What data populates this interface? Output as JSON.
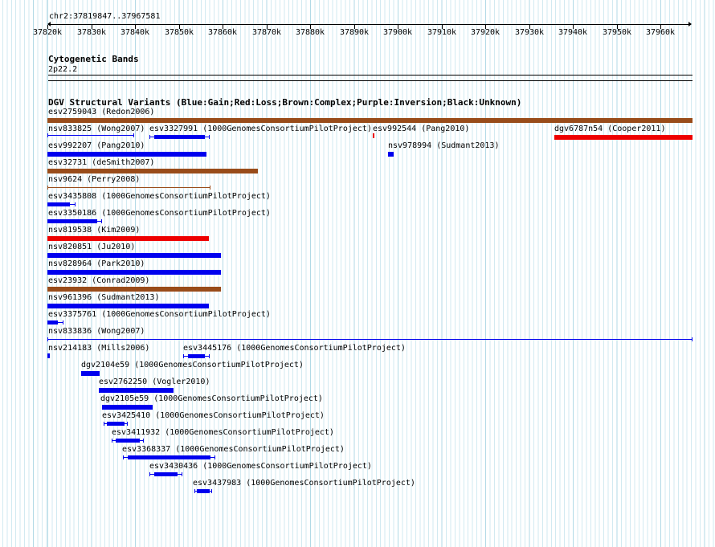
{
  "position": "chr2:37819847..37967581",
  "ruler_ticks": [
    "37820k",
    "37830k",
    "37840k",
    "37850k",
    "37860k",
    "37870k",
    "37880k",
    "37890k",
    "37900k",
    "37910k",
    "37920k",
    "37930k",
    "37940k",
    "37950k",
    "37960k"
  ],
  "cytoband": {
    "title": "Cytogenetic Bands",
    "band": "2p22.2"
  },
  "dgv": {
    "title": "DGV Structural Variants (Blue:Gain;Red:Loss;Brown:Complex;Purple:Inversion;Black:Unknown)",
    "colors": {
      "gain": "#0000ee",
      "loss": "#ee0000",
      "complex": "#994c1a",
      "inversion": "#800080",
      "unknown": "#000000"
    },
    "features": [
      {
        "label": "esv2759043 (Redon2006)",
        "type": "complex"
      },
      {
        "label": "nsv833825 (Wong2007)",
        "type": "gain"
      },
      {
        "label": "esv3327991 (1000GenomesConsortiumPilotProject)",
        "type": "gain"
      },
      {
        "label": "esv992544 (Pang2010)",
        "type": "loss"
      },
      {
        "label": "dgv6787n54 (Cooper2011)",
        "type": "loss"
      },
      {
        "label": "esv992207 (Pang2010)",
        "type": "gain"
      },
      {
        "label": "nsv978994 (Sudmant2013)",
        "type": "gain"
      },
      {
        "label": "esv32731 (deSmith2007)",
        "type": "complex"
      },
      {
        "label": "nsv9624 (Perry2008)",
        "type": "complex"
      },
      {
        "label": "esv3435808 (1000GenomesConsortiumPilotProject)",
        "type": "gain"
      },
      {
        "label": "esv3350186 (1000GenomesConsortiumPilotProject)",
        "type": "gain"
      },
      {
        "label": "nsv819538 (Kim2009)",
        "type": "loss"
      },
      {
        "label": "nsv820851 (Ju2010)",
        "type": "gain"
      },
      {
        "label": "nsv828964 (Park2010)",
        "type": "gain"
      },
      {
        "label": "esv23932 (Conrad2009)",
        "type": "complex"
      },
      {
        "label": "nsv961396 (Sudmant2013)",
        "type": "gain"
      },
      {
        "label": "esv3375761 (1000GenomesConsortiumPilotProject)",
        "type": "gain"
      },
      {
        "label": "nsv833836 (Wong2007)",
        "type": "gain"
      },
      {
        "label": "nsv214183 (Mills2006)",
        "type": "gain"
      },
      {
        "label": "esv3445176 (1000GenomesConsortiumPilotProject)",
        "type": "gain"
      },
      {
        "label": "dgv2104e59 (1000GenomesConsortiumPilotProject)",
        "type": "gain"
      },
      {
        "label": "esv2762250 (Vogler2010)",
        "type": "gain"
      },
      {
        "label": "dgv2105e59 (1000GenomesConsortiumPilotProject)",
        "type": "gain"
      },
      {
        "label": "esv3425410 (1000GenomesConsortiumPilotProject)",
        "type": "gain"
      },
      {
        "label": "esv3411932 (1000GenomesConsortiumPilotProject)",
        "type": "gain"
      },
      {
        "label": "esv3368337 (1000GenomesConsortiumPilotProject)",
        "type": "gain"
      },
      {
        "label": "esv3430436 (1000GenomesConsortiumPilotProject)",
        "type": "gain"
      },
      {
        "label": "esv3437983 (1000GenomesConsortiumPilotProject)",
        "type": "gain"
      }
    ]
  }
}
